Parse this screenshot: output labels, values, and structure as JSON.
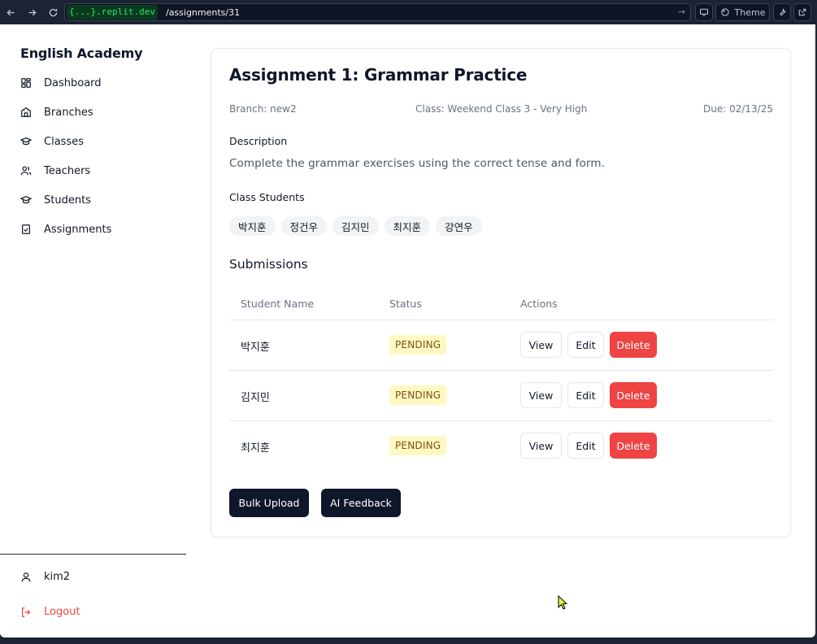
{
  "browser": {
    "url_host_braces": "{...}",
    "url_host_domain": ".replit.dev",
    "url_path": "/assignments/31",
    "theme_label": "Theme"
  },
  "sidebar": {
    "brand": "English Academy",
    "items": [
      {
        "label": "Dashboard",
        "icon": "dashboard-icon"
      },
      {
        "label": "Branches",
        "icon": "building-icon"
      },
      {
        "label": "Classes",
        "icon": "graduation-cap-icon"
      },
      {
        "label": "Teachers",
        "icon": "users-icon"
      },
      {
        "label": "Students",
        "icon": "graduation-cap-icon"
      },
      {
        "label": "Assignments",
        "icon": "clipboard-check-icon"
      }
    ],
    "user": "kim2",
    "logout": "Logout"
  },
  "assignment": {
    "title": "Assignment 1: Grammar Practice",
    "branch": "Branch: new2",
    "class": "Class: Weekend Class 3 - Very High",
    "due": "Due: 02/13/25",
    "description_label": "Description",
    "description": "Complete the grammar exercises using the correct tense and form.",
    "students_label": "Class Students",
    "students": [
      "박지훈",
      "정건우",
      "김지민",
      "최지훈",
      "강연우"
    ]
  },
  "submissions": {
    "title": "Submissions",
    "headers": [
      "Student Name",
      "Status",
      "Actions"
    ],
    "rows": [
      {
        "name": "박지훈",
        "status": "PENDING"
      },
      {
        "name": "김지민",
        "status": "PENDING"
      },
      {
        "name": "최지훈",
        "status": "PENDING"
      }
    ],
    "view_label": "View",
    "edit_label": "Edit",
    "delete_label": "Delete"
  },
  "actions": {
    "bulk_upload": "Bulk Upload",
    "ai_feedback": "AI Feedback"
  },
  "colors": {
    "primary": "#0f172a",
    "danger": "#ef4444",
    "pending_bg": "#fef9c3",
    "pending_text": "#854d0e"
  }
}
